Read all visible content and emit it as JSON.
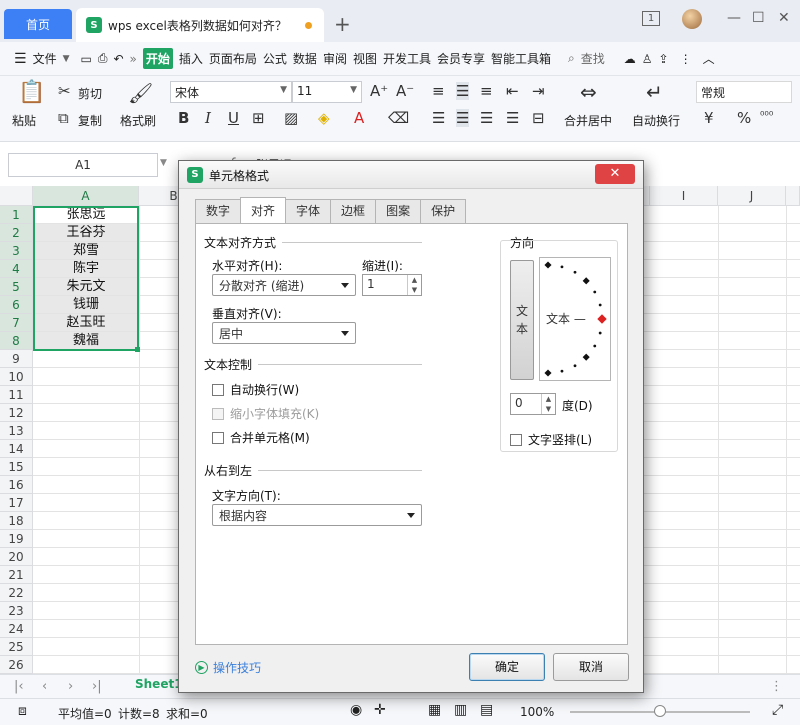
{
  "window": {
    "home_tab": "首页",
    "doc_tab_title": "wps excel表格列数据如何对齐？",
    "new_tab": "+",
    "controls": [
      "1",
      "—",
      "☐",
      "✕"
    ]
  },
  "menubar": {
    "file": "文件",
    "more": "»",
    "items": [
      "开始",
      "插入",
      "页面布局",
      "公式",
      "数据",
      "审阅",
      "视图",
      "开发工具",
      "会员专享",
      "智能工具箱"
    ],
    "search": "查找"
  },
  "ribbon": {
    "paste": "粘贴",
    "cut": "剪切",
    "copy": "复制",
    "format_painter": "格式刷",
    "font_name": "宋体",
    "font_size": "11",
    "bold": "B",
    "italic": "I",
    "underline": "U",
    "merge_center": "合并居中",
    "auto_wrap": "自动换行",
    "number_format": "常规",
    "currency": "¥",
    "percent": "%"
  },
  "formula_bar": {
    "cell_ref": "A1",
    "fx": "fx",
    "content": "张思远"
  },
  "grid": {
    "columns": [
      "A",
      "B",
      "I",
      "J"
    ],
    "cells": [
      "张思远",
      "王谷芬",
      "郑雪",
      "陈宇",
      "朱元文",
      "钱珊",
      "赵玉旺",
      "魏福"
    ],
    "row_numbers": [
      "1",
      "2",
      "3",
      "4",
      "5",
      "6",
      "7",
      "8",
      "9",
      "10",
      "11",
      "12",
      "13",
      "14",
      "15",
      "16",
      "17",
      "18",
      "19",
      "20",
      "21",
      "22",
      "23",
      "24",
      "25",
      "26"
    ]
  },
  "sheetbar": {
    "sheet_name": "Sheet1"
  },
  "statusbar": {
    "average": "平均值=0",
    "count": "计数=8",
    "sum": "求和=0",
    "zoom": "100%",
    "zoom_level": 0.5
  },
  "dialog": {
    "title": "单元格格式",
    "tabs": [
      "数字",
      "对齐",
      "字体",
      "边框",
      "图案",
      "保护"
    ],
    "active_tab": "对齐",
    "text_align_section": "文本对齐方式",
    "horizontal_label": "水平对齐(H):",
    "horizontal_value": "分散对齐 (缩进)",
    "indent_label": "缩进(I):",
    "indent_value": "1",
    "vertical_label": "垂直对齐(V):",
    "vertical_value": "居中",
    "text_control_section": "文本控制",
    "wrap_text": "自动换行(W)",
    "shrink_to_fit": "缩小字体填充(K)",
    "merge_cells": "合并单元格(M)",
    "rtl_section": "从右到左",
    "text_direction_label": "文字方向(T):",
    "text_direction_value": "根据内容",
    "orientation_section": "方向",
    "vertical_text_chars": [
      "文",
      "本"
    ],
    "dial_text": "文本 —",
    "degree_value": "0",
    "degree_label": "度(D)",
    "vertical_text_label": "文字竖排(L)",
    "tips": "操作技巧",
    "ok": "确定",
    "cancel": "取消"
  },
  "colors": {
    "accent_green": "#1fa463",
    "home_tab_blue": "#3d7ff5",
    "close_red": "#e04343"
  }
}
